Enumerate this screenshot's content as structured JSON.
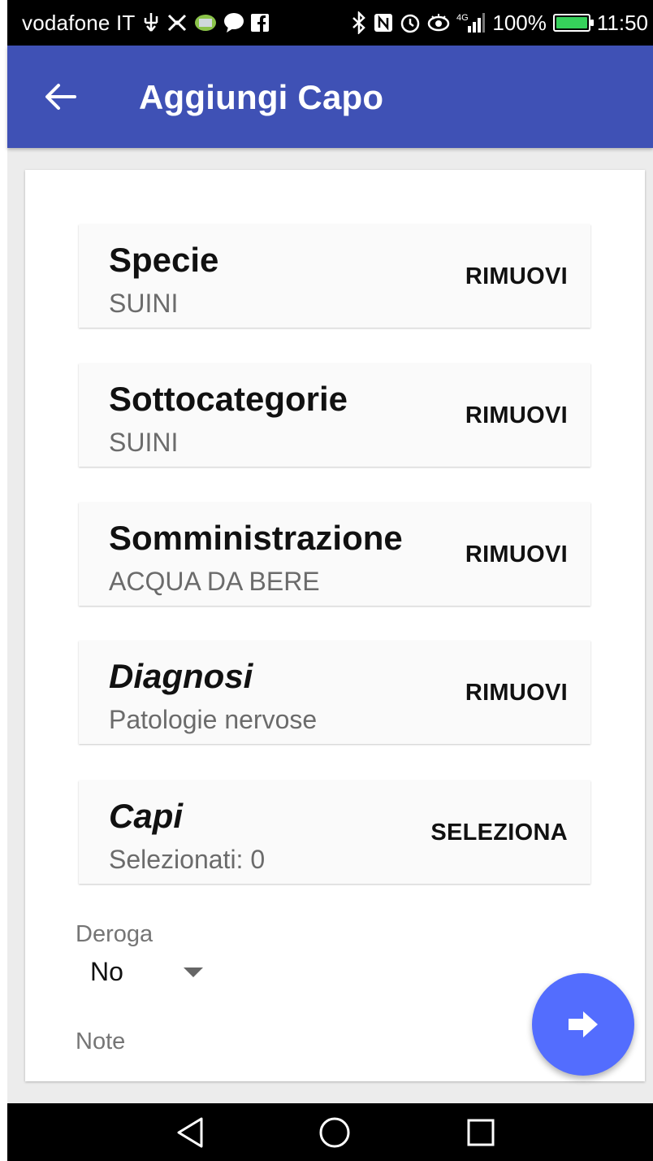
{
  "status_bar": {
    "carrier": "vodafone IT",
    "signal_label": "4G",
    "battery_percent": "100%",
    "battery_level": 1.0,
    "time": "11:50",
    "icons": [
      "usb-icon",
      "notification-icon",
      "app-icon",
      "chat-icon",
      "facebook-icon",
      "bluetooth-icon",
      "nfc-icon",
      "alarm-icon",
      "eye-icon",
      "signal-icon",
      "battery-icon"
    ]
  },
  "app_bar": {
    "title": "Aggiungi Capo",
    "back_icon": "arrow-back-icon"
  },
  "rows": [
    {
      "title": "Specie",
      "value": "SUINI",
      "action": "RIMUOVI",
      "italic": false
    },
    {
      "title": "Sottocategorie",
      "value": "SUINI",
      "action": "RIMUOVI",
      "italic": false
    },
    {
      "title": "Somministrazione",
      "value": "ACQUA DA BERE",
      "action": "RIMUOVI",
      "italic": false
    },
    {
      "title": "Diagnosi",
      "value": "Patologie nervose",
      "action": "RIMUOVI",
      "italic": true
    },
    {
      "title": "Capi",
      "value": "Selezionati: 0",
      "action": "SELEZIONA",
      "italic": true
    }
  ],
  "deroga": {
    "label": "Deroga",
    "value": "No"
  },
  "note": {
    "label": "Note"
  },
  "fab": {
    "icon": "arrow-forward-icon"
  },
  "colors": {
    "app_bar": "#3f51b5",
    "fab": "#536dfe",
    "battery": "#36d15b"
  },
  "nav_bar": {
    "icons": [
      "back-triangle-icon",
      "home-circle-icon",
      "recents-square-icon"
    ]
  }
}
